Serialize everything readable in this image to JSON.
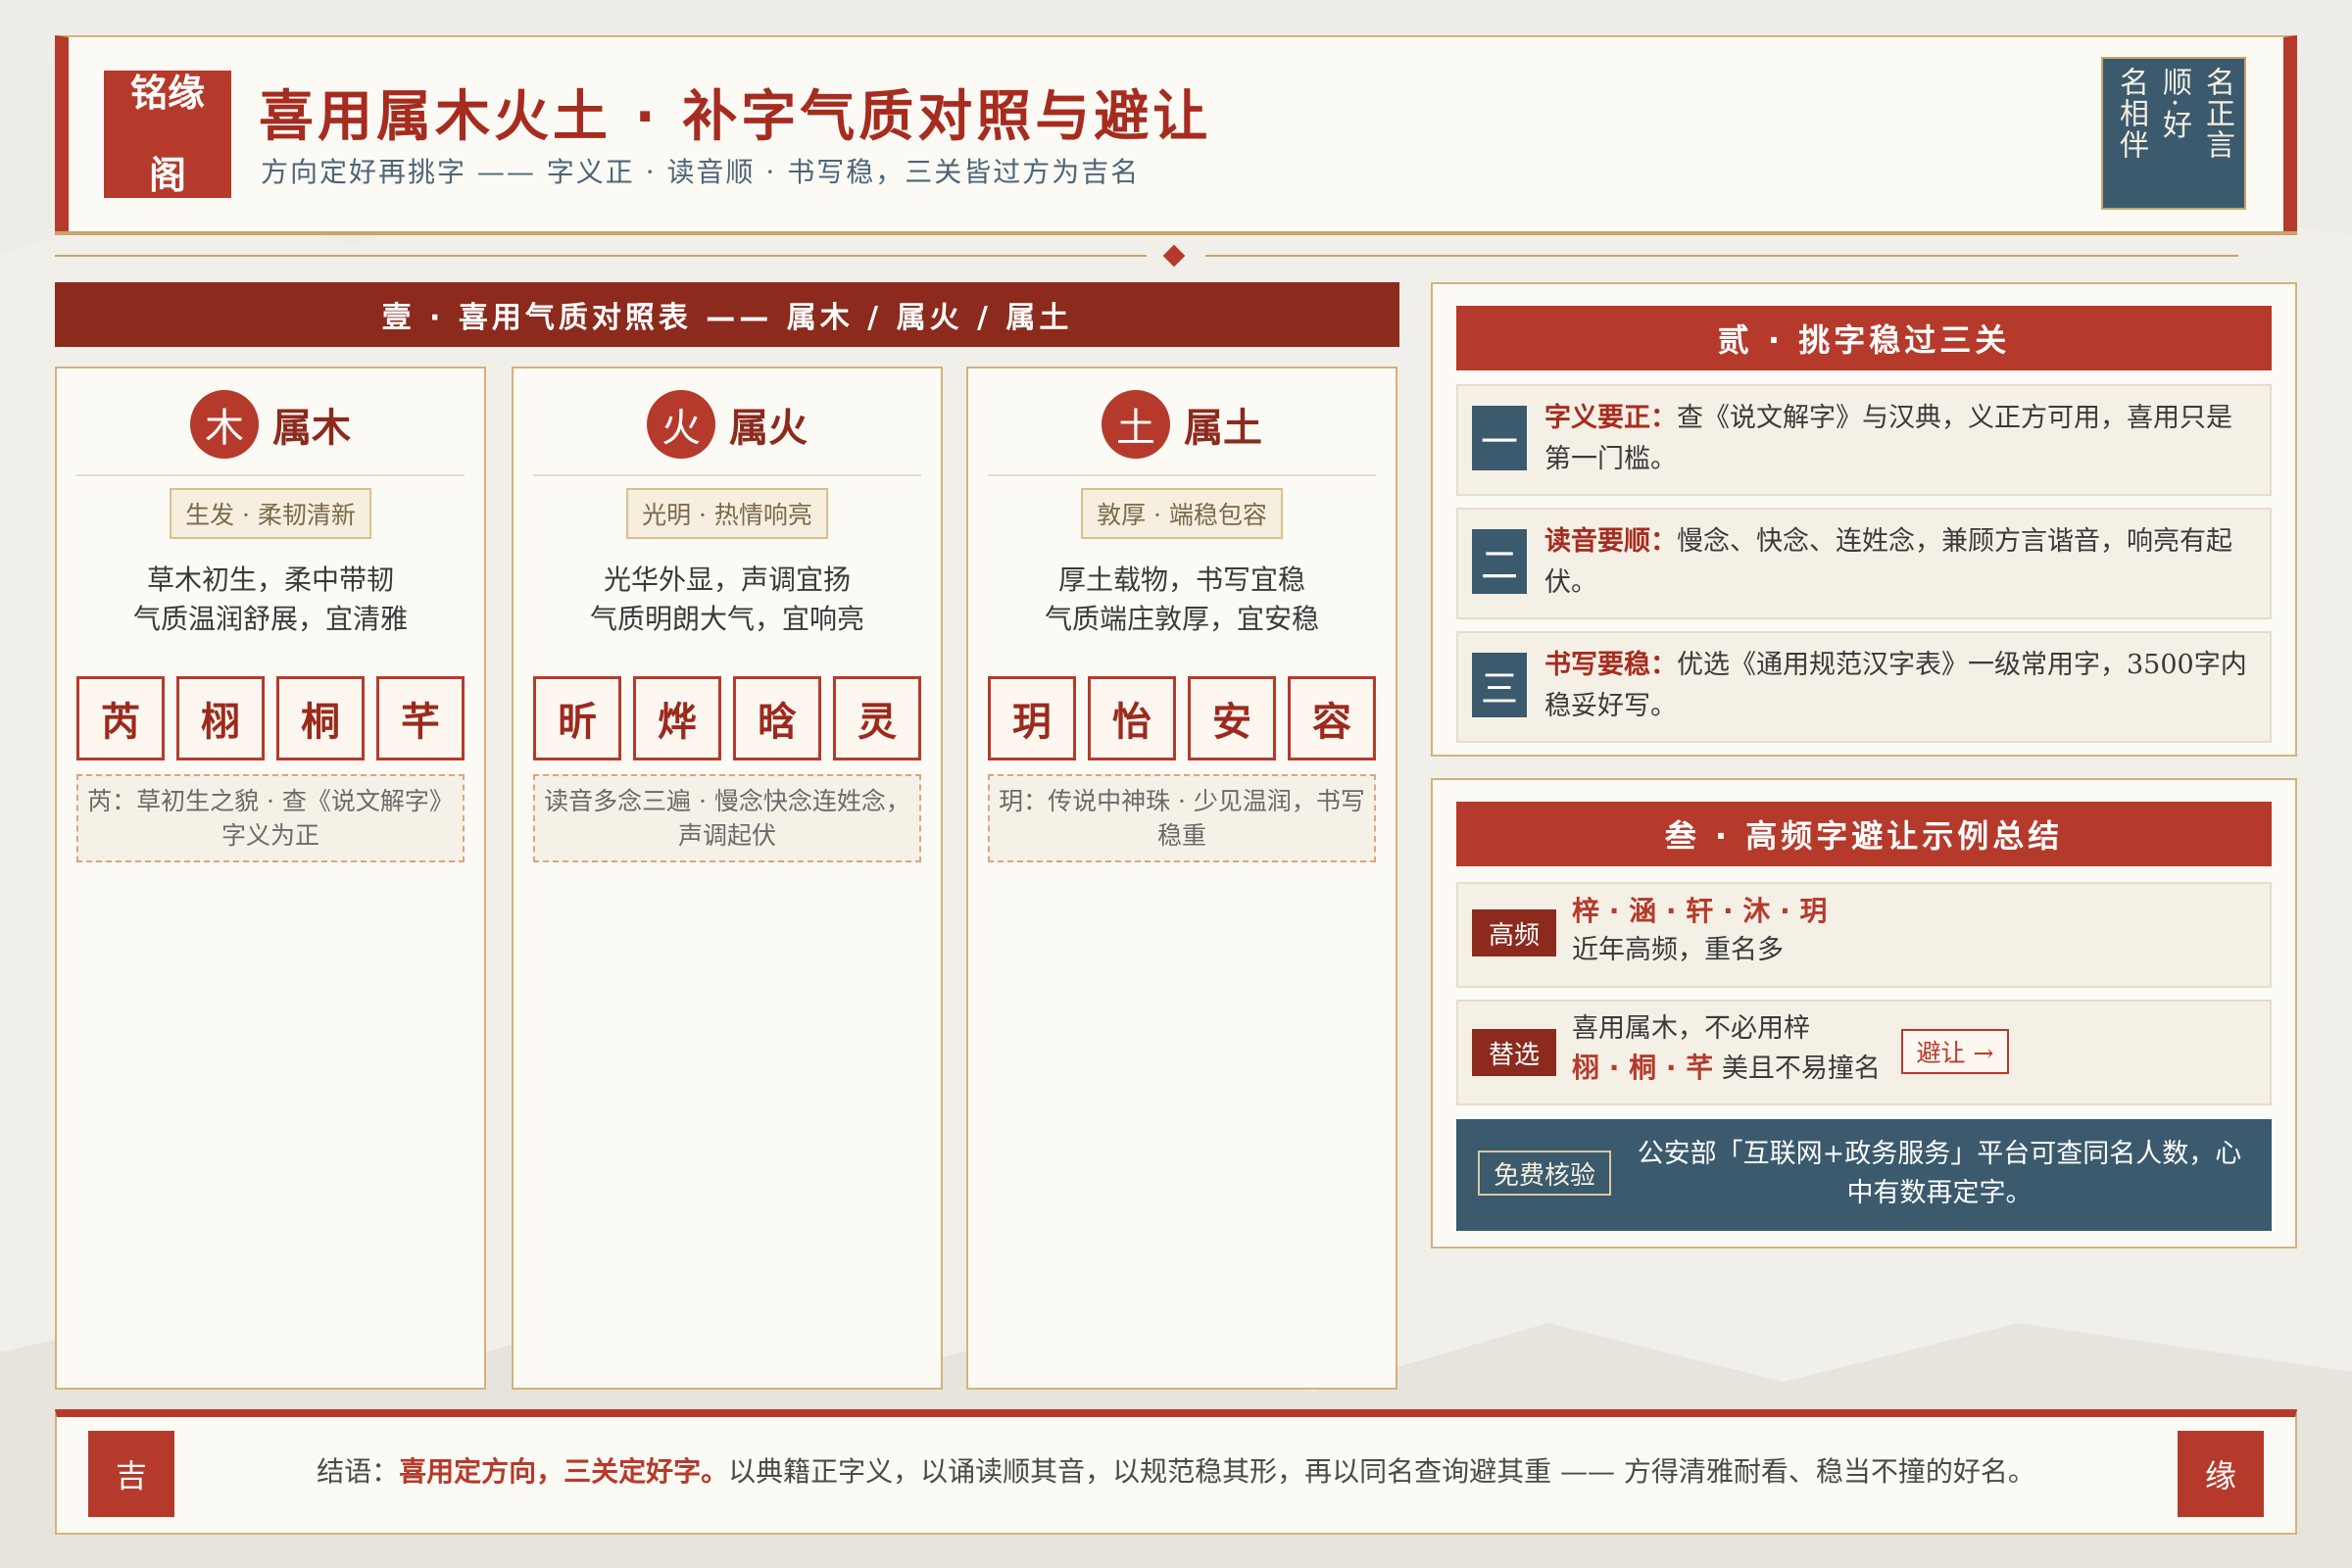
{
  "header": {
    "seal": "铭缘阁",
    "seal_line1": "铭缘",
    "seal_line2": "阁",
    "title": "喜用属木火土 · 补字气质对照与避让",
    "subtitle": "方向定好再挑字 —— 字义正 · 读音顺 · 书写稳，三关皆过方为吉名",
    "motto_cols": [
      "名正言",
      "顺·好",
      "名相伴"
    ]
  },
  "section1": {
    "title": "壹 · 喜用气质对照表 —— 属木 / 属火 / 属土",
    "elements": [
      {
        "symbol": "木",
        "name": "属木",
        "tag": "生发 · 柔韧清新",
        "desc_line1": "草木初生，柔中带韧",
        "desc_line2": "气质温润舒展，宜清雅",
        "chars": [
          "芮",
          "栩",
          "桐",
          "芊"
        ],
        "note": "芮：草初生之貌 · 查《说文解字》字义为正"
      },
      {
        "symbol": "火",
        "name": "属火",
        "tag": "光明 · 热情响亮",
        "desc_line1": "光华外显，声调宜扬",
        "desc_line2": "气质明朗大气，宜响亮",
        "chars": [
          "昕",
          "烨",
          "晗",
          "灵"
        ],
        "note": "读音多念三遍 · 慢念快念连姓念，声调起伏"
      },
      {
        "symbol": "土",
        "name": "属土",
        "tag": "敦厚 · 端稳包容",
        "desc_line1": "厚土载物，书写宜稳",
        "desc_line2": "气质端庄敦厚，宜安稳",
        "chars": [
          "玥",
          "怡",
          "安",
          "容"
        ],
        "note": "玥：传说中神珠 · 少见温润，书写稳重"
      }
    ]
  },
  "section2": {
    "title": "贰 · 挑字稳过三关",
    "rules": [
      {
        "num": "一",
        "label": "字义要正：",
        "text": "查《说文解字》与汉典，义正方可用，喜用只是第一门槛。"
      },
      {
        "num": "二",
        "label": "读音要顺：",
        "text": "慢念、快念、连姓念，兼顾方言谐音，响亮有起伏。"
      },
      {
        "num": "三",
        "label": "书写要稳：",
        "text": "优选《通用规范汉字表》一级常用字，3500字内稳妥好写。"
      }
    ]
  },
  "section3": {
    "title": "叁 · 高频字避让示例总结",
    "high": {
      "tag": "高频",
      "chars": "梓 · 涵 · 轩 · 沐 · 玥",
      "text": "近年高频，重名多"
    },
    "alt": {
      "tag": "替选",
      "line1": "喜用属木，不必用梓",
      "chars": "栩 · 桐 · 芊",
      "line2": "美且不易撞名",
      "button": "避让 →"
    },
    "verify": {
      "tag": "免费核验",
      "text": "公安部「互联网+政务服务」平台可查同名人数，心中有数再定字。"
    }
  },
  "footer": {
    "left_seal": "吉",
    "right_seal": "缘",
    "prefix": "结语：",
    "emph": "喜用定方向，三关定好字。",
    "text": "以典籍正字义，以诵读顺其音，以规范稳其形，再以同名查询避其重 —— 方得清雅耐看、稳当不撞的好名。"
  },
  "colors": {
    "red": "#b63a2b",
    "dark_red": "#8c2a1d",
    "slate": "#3b5a6e",
    "gold": "#d4b27a",
    "paper": "#fcfaf4"
  }
}
